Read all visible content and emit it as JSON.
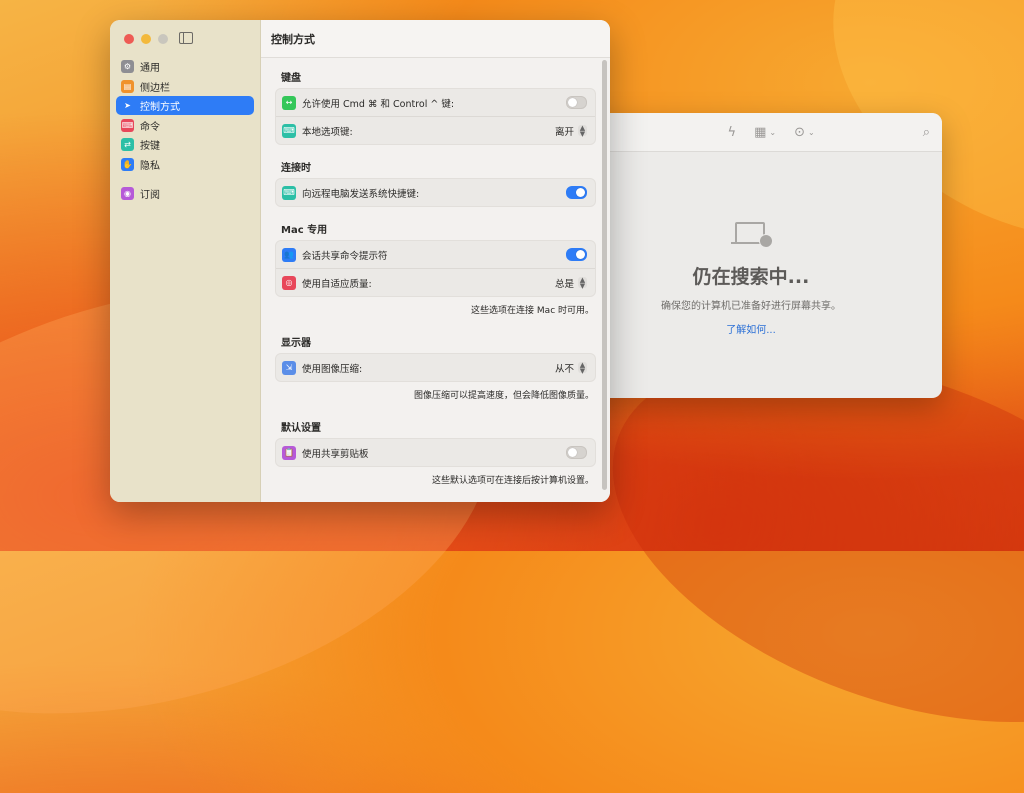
{
  "sidebar": {
    "items": [
      {
        "label": "通用",
        "icon": "gear-icon",
        "color": "#8e8e93"
      },
      {
        "label": "侧边栏",
        "icon": "sidebar-icon",
        "color": "#f0922c"
      },
      {
        "label": "控制方式",
        "icon": "cursor-icon",
        "color": "#2e7cf6",
        "active": true
      },
      {
        "label": "命令",
        "icon": "keyboard-icon",
        "color": "#e8475a"
      },
      {
        "label": "按键",
        "icon": "keys-icon",
        "color": "#2cbfa6"
      },
      {
        "label": "隐私",
        "icon": "hand-icon",
        "color": "#2e7cf6"
      },
      {
        "label": "订阅",
        "icon": "subscription-icon",
        "color": "#b65ad8"
      }
    ]
  },
  "main": {
    "title": "控制方式",
    "sections": {
      "keyboard": {
        "title": "键盘",
        "rows": {
          "allow_cmd": {
            "label": "允许使用 Cmd ⌘ 和 Control ^ 键:",
            "state": "off"
          },
          "local_option": {
            "label": "本地选项键:",
            "value": "离开"
          }
        }
      },
      "connected": {
        "title": "连接时",
        "rows": {
          "send_shortcuts": {
            "label": "向远程电脑发送系统快捷键:",
            "state": "on"
          }
        }
      },
      "mac_only": {
        "title": "Mac 专用",
        "rows": {
          "share_prompt": {
            "label": "会话共享命令提示符",
            "state": "on"
          },
          "adaptive_quality": {
            "label": "使用自适应质量:",
            "value": "总是"
          }
        },
        "note": "这些选项在连接 Mac 时可用。"
      },
      "display": {
        "title": "显示器",
        "rows": {
          "compression": {
            "label": "使用图像压缩:",
            "value": "从不"
          }
        },
        "note": "图像压缩可以提高速度，但会降低图像质量。"
      },
      "defaults": {
        "title": "默认设置",
        "rows": {
          "clipboard": {
            "label": "使用共享剪贴板",
            "state": "off"
          }
        },
        "note": "这些默认选项可在连接后按计算机设置。"
      }
    }
  },
  "back_window": {
    "title": "仍在搜索中...",
    "subtitle": "确保您的计算机已准备好进行屏幕共享。",
    "link": "了解如何..."
  },
  "colors": {
    "accent": "#2e7cf6"
  }
}
